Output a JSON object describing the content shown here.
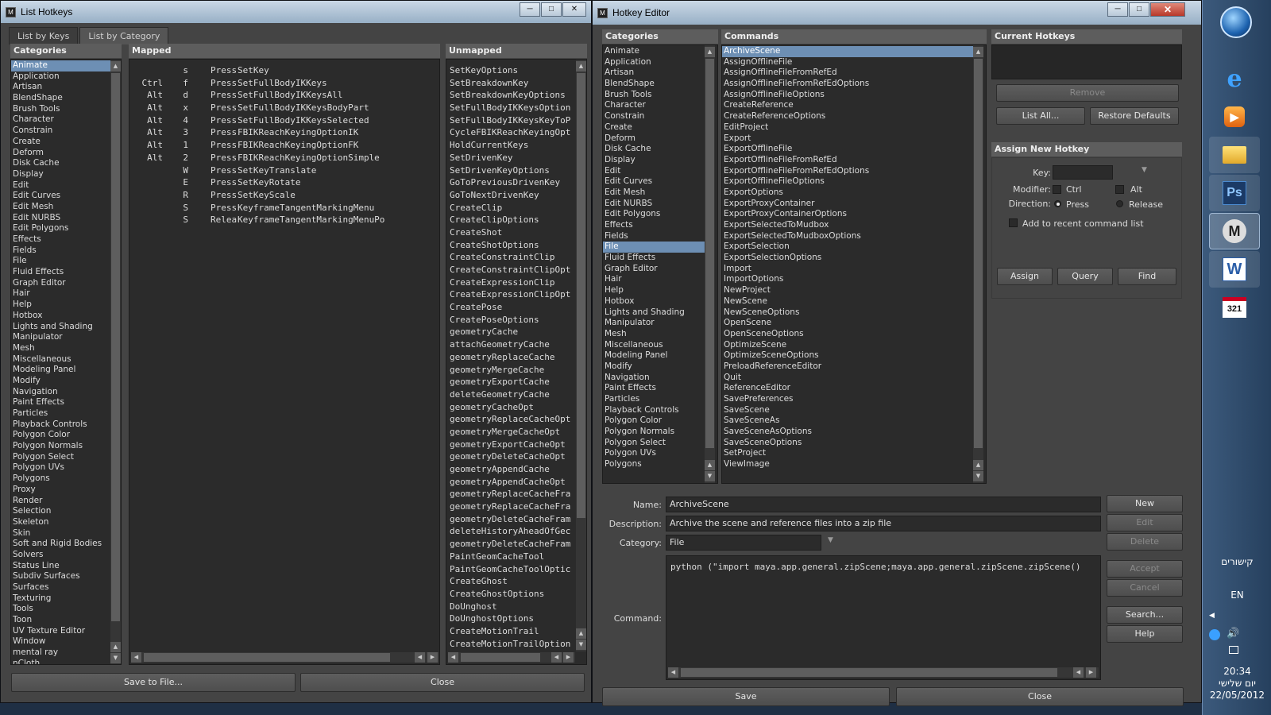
{
  "list_hotkeys": {
    "title": "List Hotkeys",
    "tabs": [
      "List by Keys",
      "List by Category"
    ],
    "categories_header": "Categories",
    "mapped_header": "Mapped",
    "unmapped_header": "Unmapped",
    "categories": [
      "Animate",
      "Application",
      "Artisan",
      "BlendShape",
      "Brush Tools",
      "Character",
      "Constrain",
      "Create",
      "Deform",
      "Disk Cache",
      "Display",
      "Edit",
      "Edit Curves",
      "Edit Mesh",
      "Edit NURBS",
      "Edit Polygons",
      "Effects",
      "Fields",
      "File",
      "Fluid Effects",
      "Graph Editor",
      "Hair",
      "Help",
      "Hotbox",
      "Lights and Shading",
      "Manipulator",
      "Mesh",
      "Miscellaneous",
      "Modeling Panel",
      "Modify",
      "Navigation",
      "Paint Effects",
      "Particles",
      "Playback Controls",
      "Polygon Color",
      "Polygon Normals",
      "Polygon Select",
      "Polygon UVs",
      "Polygons",
      "Proxy",
      "Render",
      "Selection",
      "Skeleton",
      "Skin",
      "Soft and Rigid Bodies",
      "Solvers",
      "Status Line",
      "Subdiv Surfaces",
      "Surfaces",
      "Texturing",
      "Tools",
      "Toon",
      "UV Texture Editor",
      "Window",
      "mental ray",
      "nCloth"
    ],
    "mapped": [
      {
        "mod": "",
        "key": "s",
        "dir": "Press",
        "cmd": "SetKey"
      },
      {
        "mod": "Ctrl",
        "key": "f",
        "dir": "Press",
        "cmd": "SetFullBodyIKKeys"
      },
      {
        "mod": "Alt",
        "key": "d",
        "dir": "Press",
        "cmd": "SetFullBodyIKKeysAll"
      },
      {
        "mod": "Alt",
        "key": "x",
        "dir": "Press",
        "cmd": "SetFullBodyIKKeysBodyPart"
      },
      {
        "mod": "Alt",
        "key": "4",
        "dir": "Press",
        "cmd": "SetFullBodyIKKeysSelected"
      },
      {
        "mod": "Alt",
        "key": "3",
        "dir": "Press",
        "cmd": "FBIKReachKeyingOptionIK"
      },
      {
        "mod": "Alt",
        "key": "1",
        "dir": "Press",
        "cmd": "FBIKReachKeyingOptionFK"
      },
      {
        "mod": "Alt",
        "key": "2",
        "dir": "Press",
        "cmd": "FBIKReachKeyingOptionSimple"
      },
      {
        "mod": "",
        "key": "W",
        "dir": "Press",
        "cmd": "SetKeyTranslate"
      },
      {
        "mod": "",
        "key": "E",
        "dir": "Press",
        "cmd": "SetKeyRotate"
      },
      {
        "mod": "",
        "key": "R",
        "dir": "Press",
        "cmd": "SetKeyScale"
      },
      {
        "mod": "",
        "key": "S",
        "dir": "Press",
        "cmd": "KeyframeTangentMarkingMenu"
      },
      {
        "mod": "",
        "key": "S",
        "dir": "Release",
        "cmd": "KeyframeTangentMarkingMenuPo"
      }
    ],
    "unmapped": [
      "SetKeyOptions",
      "SetBreakdownKey",
      "SetBreakdownKeyOptions",
      "SetFullBodyIKKeysOption",
      "SetFullBodyIKKeysKeyToP",
      "CycleFBIKReachKeyingOpt",
      "HoldCurrentKeys",
      "SetDrivenKey",
      "SetDrivenKeyOptions",
      "GoToPreviousDrivenKey",
      "GoToNextDrivenKey",
      "CreateClip",
      "CreateClipOptions",
      "CreateShot",
      "CreateShotOptions",
      "CreateConstraintClip",
      "CreateConstraintClipOpt",
      "CreateExpressionClip",
      "CreateExpressionClipOpt",
      "CreatePose",
      "CreatePoseOptions",
      "geometryCache",
      "attachGeometryCache",
      "geometryReplaceCache",
      "geometryMergeCache",
      "geometryExportCache",
      "deleteGeometryCache",
      "geometryCacheOpt",
      "geometryReplaceCacheOpt",
      "geometryMergeCacheOpt",
      "geometryExportCacheOpt",
      "geometryDeleteCacheOpt",
      "geometryAppendCache",
      "geometryAppendCacheOpt",
      "geometryReplaceCacheFra",
      "geometryReplaceCacheFra",
      "geometryDeleteCacheFram",
      "deleteHistoryAheadOfGec",
      "geometryDeleteCacheFram",
      "PaintGeomCacheTool",
      "PaintGeomCacheToolOptic",
      "CreateGhost",
      "CreateGhostOptions",
      "DoUnghost",
      "DoUnghostOptions",
      "CreateMotionTrail",
      "CreateMotionTrailOption"
    ],
    "save_label": "Save to File...",
    "close_label": "Close"
  },
  "hotkey_editor": {
    "title": "Hotkey Editor",
    "categories_header": "Categories",
    "commands_header": "Commands",
    "current_hotkeys_header": "Current Hotkeys",
    "categories": [
      "Animate",
      "Application",
      "Artisan",
      "BlendShape",
      "Brush Tools",
      "Character",
      "Constrain",
      "Create",
      "Deform",
      "Disk Cache",
      "Display",
      "Edit",
      "Edit Curves",
      "Edit Mesh",
      "Edit NURBS",
      "Edit Polygons",
      "Effects",
      "Fields",
      "File",
      "Fluid Effects",
      "Graph Editor",
      "Hair",
      "Help",
      "Hotbox",
      "Lights and Shading",
      "Manipulator",
      "Mesh",
      "Miscellaneous",
      "Modeling Panel",
      "Modify",
      "Navigation",
      "Paint Effects",
      "Particles",
      "Playback Controls",
      "Polygon Color",
      "Polygon Normals",
      "Polygon Select",
      "Polygon UVs",
      "Polygons"
    ],
    "selected_category": "File",
    "commands": [
      "ArchiveScene",
      "AssignOfflineFile",
      "AssignOfflineFileFromRefEd",
      "AssignOfflineFileFromRefEdOptions",
      "AssignOfflineFileOptions",
      "CreateReference",
      "CreateReferenceOptions",
      "EditProject",
      "Export",
      "ExportOfflineFile",
      "ExportOfflineFileFromRefEd",
      "ExportOfflineFileFromRefEdOptions",
      "ExportOfflineFileOptions",
      "ExportOptions",
      "ExportProxyContainer",
      "ExportProxyContainerOptions",
      "ExportSelectedToMudbox",
      "ExportSelectedToMudboxOptions",
      "ExportSelection",
      "ExportSelectionOptions",
      "Import",
      "ImportOptions",
      "NewProject",
      "NewScene",
      "NewSceneOptions",
      "OpenScene",
      "OpenSceneOptions",
      "OptimizeScene",
      "OptimizeSceneOptions",
      "PreloadReferenceEditor",
      "Quit",
      "ReferenceEditor",
      "SavePreferences",
      "SaveScene",
      "SaveSceneAs",
      "SaveSceneAsOptions",
      "SaveSceneOptions",
      "SetProject",
      "ViewImage"
    ],
    "selected_command": "ArchiveScene",
    "remove_label": "Remove",
    "list_all_label": "List All...",
    "restore_defaults_label": "Restore Defaults",
    "assign_new_header": "Assign New Hotkey",
    "key_label": "Key:",
    "key_value": "",
    "modifier_label": "Modifier:",
    "ctrl_label": "Ctrl",
    "alt_label": "Alt",
    "direction_label": "Direction:",
    "press_label": "Press",
    "release_label": "Release",
    "direction_value": "Press",
    "recent_label": "Add to recent command list",
    "assign_label": "Assign",
    "query_label": "Query",
    "find_label": "Find",
    "name_label": "Name:",
    "name_value": "ArchiveScene",
    "description_label": "Description:",
    "description_value": "Archive the scene and reference files into a zip file",
    "category_label": "Category:",
    "category_value": "File",
    "command_label": "Command:",
    "command_value": "python (\"import maya.app.general.zipScene;maya.app.general.zipScene.zipScene()",
    "new_label": "New",
    "edit_label": "Edit",
    "delete_label": "Delete",
    "accept_label": "Accept",
    "cancel_label": "Cancel",
    "search_label": "Search...",
    "help_label": "Help",
    "save_label": "Save",
    "close_label": "Close"
  },
  "taskbar": {
    "language_label": "קישורים",
    "lang": "EN",
    "time": "20:34",
    "day": "יום שלישי",
    "date": "22/05/2012",
    "calendar_number": "321",
    "ps_label": "Ps",
    "word_label": "W"
  }
}
